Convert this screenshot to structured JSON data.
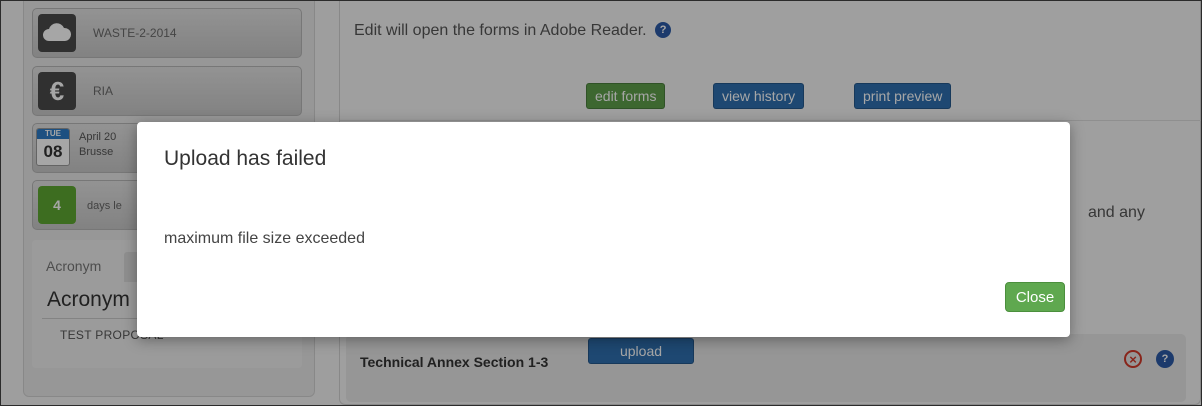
{
  "sidebar": {
    "tiles": {
      "call_label": "WASTE-2-2014",
      "euro_label": "RIA",
      "date_weekday": "TUE",
      "date_day": "08",
      "date_line1": "April 20",
      "date_line2": "Brusse",
      "days_count": "4",
      "days_label": "days le"
    },
    "acronym": {
      "tab_label": "Acronym",
      "title": "Acronym",
      "value": "TEST PROPOSAL"
    }
  },
  "main": {
    "edit_note": "Edit will open the forms in Adobe Reader.",
    "buttons": {
      "edit_forms": "edit forms",
      "view_history": "view history",
      "print_preview": "print preview"
    },
    "partial_text": "and any",
    "row": {
      "label": "Technical Annex Section 1-3",
      "upload": "upload"
    }
  },
  "modal": {
    "title": "Upload has failed",
    "message": "maximum file size exceeded",
    "close_label": "Close"
  },
  "icons": {
    "cloud": "cloud-icon",
    "euro": "euro-icon",
    "help": "help-icon",
    "error": "error-circle-icon"
  },
  "colors": {
    "green_button": "#5e9e4b",
    "blue_button": "#2e6fb0",
    "help_blue": "#2c5aa6",
    "error_red": "#d23a2a"
  }
}
